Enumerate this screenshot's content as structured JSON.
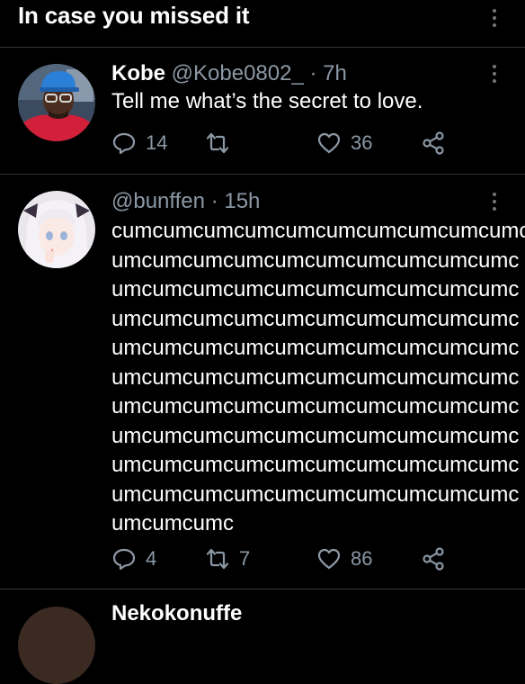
{
  "header": {
    "title": "In case you missed it"
  },
  "tweets": [
    {
      "name": "Kobe",
      "handle": "@Kobe0802_",
      "time": "· 7h",
      "text": "Tell me what’s the secret to love.",
      "replies": "14",
      "retweets": "",
      "likes": "36"
    },
    {
      "name": "",
      "handle": "@bunffen",
      "time": "· 15h",
      "lines": [
        "cumcumcumcumcumcumcumcumcumcumc",
        "umcumcumcumcumcumcumcumcumcumc",
        "umcumcumcumcumcumcumcumcumcumc",
        "umcumcumcumcumcumcumcumcumcumc",
        "umcumcumcumcumcumcumcumcumcumc",
        "umcumcumcumcumcumcumcumcumcumc",
        "umcumcumcumcumcumcumcumcumcumc",
        "umcumcumcumcumcumcumcumcumcumc",
        "umcumcumcumcumcumcumcumcumcumc",
        "umcumcumcumcumcumcumcumcumcumc",
        "umcumcumc"
      ],
      "replies": "4",
      "retweets": "7",
      "likes": "86"
    }
  ],
  "next_tweet": {
    "name": "Nekokonuffe"
  },
  "colors": {
    "background": "#000000",
    "secondary_text": "#8b98a5",
    "divider": "#2f3336"
  },
  "icons": [
    "more-vertical-icon",
    "reply-icon",
    "retweet-icon",
    "like-icon",
    "share-icon"
  ]
}
